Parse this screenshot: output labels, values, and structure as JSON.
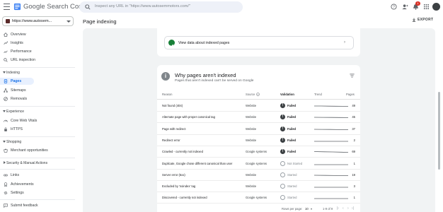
{
  "header": {
    "brand": "Google Search Console",
    "search_placeholder": "Inspect any URL in \"https://www.autosemmotors.com/\"",
    "notifications_count": "1"
  },
  "sidebar": {
    "property": "https://www.autosem...",
    "items_top": [
      {
        "label": "Overview",
        "icon": "home-icon"
      },
      {
        "label": "Insights",
        "icon": "insights-icon"
      },
      {
        "label": "Performance",
        "icon": "performance-icon"
      },
      {
        "label": "URL inspection",
        "icon": "search-icon"
      }
    ],
    "section_indexing": "Indexing",
    "items_indexing": [
      {
        "label": "Pages",
        "icon": "pages-icon",
        "active": true
      },
      {
        "label": "Sitemaps",
        "icon": "sitemaps-icon"
      },
      {
        "label": "Removals",
        "icon": "removals-icon"
      }
    ],
    "section_experience": "Experience",
    "items_experience": [
      {
        "label": "Core Web Vitals",
        "icon": "speed-icon"
      },
      {
        "label": "HTTPS",
        "icon": "lock-icon"
      }
    ],
    "section_shopping": "Shopping",
    "items_shopping": [
      {
        "label": "Merchant opportunities",
        "icon": "merchant-icon"
      }
    ],
    "section_security": "Security & Manual Actions",
    "items_bottom": [
      {
        "label": "Links",
        "icon": "links-icon"
      },
      {
        "label": "Achievements",
        "icon": "achievements-icon"
      },
      {
        "label": "Settings",
        "icon": "settings-icon"
      }
    ],
    "feedback": "Submit feedback"
  },
  "main": {
    "title": "Page indexing",
    "export_label": "EXPORT",
    "view_data_label": "View data about indexed pages",
    "why_title": "Why pages aren't indexed",
    "why_subtitle": "Pages that aren't indexed can't be served on Google",
    "columns": {
      "reason": "Reason",
      "source": "Source",
      "validation": "Validation",
      "trend": "Trend",
      "pages": "Pages"
    },
    "rows": [
      {
        "reason": "Not found (404)",
        "source": "Website",
        "validation": "Failed",
        "pages": "49"
      },
      {
        "reason": "Alternate page with proper canonical tag",
        "source": "Website",
        "validation": "Failed",
        "pages": "45"
      },
      {
        "reason": "Page with redirect",
        "source": "Website",
        "validation": "Failed",
        "pages": "37"
      },
      {
        "reason": "Redirect error",
        "source": "Website",
        "validation": "Failed",
        "pages": "2"
      },
      {
        "reason": "Crawled - currently not indexed",
        "source": "Google systems",
        "validation": "Failed",
        "pages": "69"
      },
      {
        "reason": "Duplicate, Google chose different canonical than user",
        "source": "Google systems",
        "validation": "Not Started",
        "pages": "1"
      },
      {
        "reason": "Server error (5xx)",
        "source": "Website",
        "validation": "Started",
        "pages": "19"
      },
      {
        "reason": "Excluded by 'noindex' tag",
        "source": "Website",
        "validation": "Started",
        "pages": "3"
      },
      {
        "reason": "Discovered - currently not indexed",
        "source": "Google systems",
        "validation": "Started",
        "pages": "1"
      }
    ],
    "pager": {
      "rows_per_page_label": "Rows per page:",
      "rows_per_page_value": "10",
      "range": "1-9 of 9"
    }
  },
  "colors": {
    "accent": "#1a73e8",
    "success": "#188038",
    "alert": "#d93025"
  }
}
